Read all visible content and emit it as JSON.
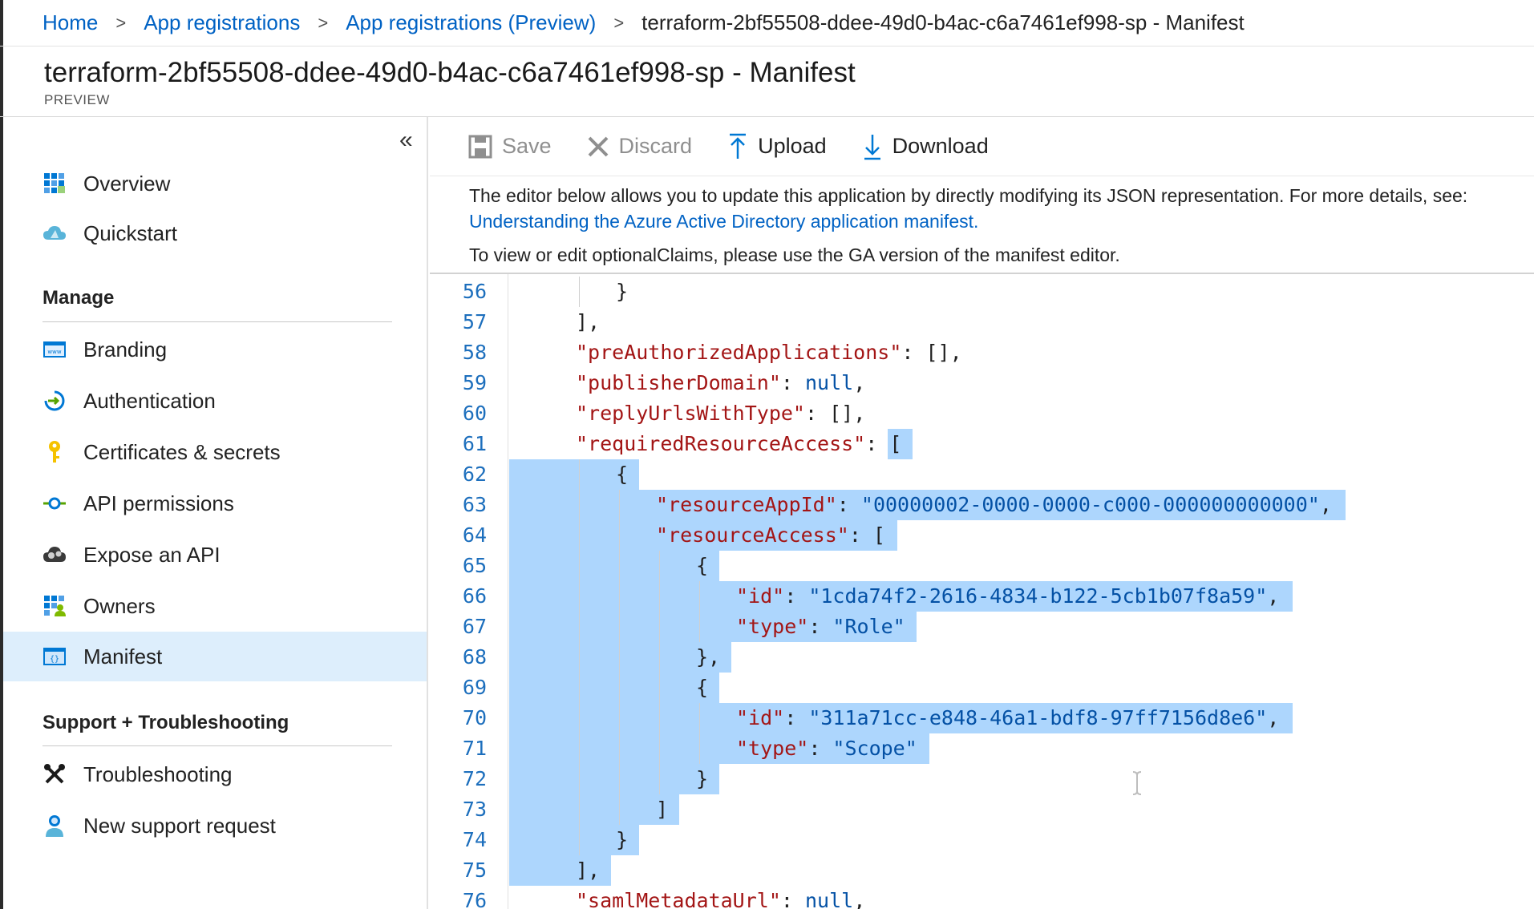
{
  "breadcrumb": {
    "items": [
      "Home",
      "App registrations",
      "App registrations (Preview)"
    ],
    "current": "terraform-2bf55508-ddee-49d0-b4ac-c6a7461ef998-sp - Manifest",
    "separator": ">"
  },
  "header": {
    "title": "terraform-2bf55508-ddee-49d0-b4ac-c6a7461ef998-sp - Manifest",
    "subtitle": "PREVIEW"
  },
  "sidebar": {
    "collapse_glyph": "«",
    "items": [
      {
        "label": "Overview",
        "icon": "grid-icon"
      },
      {
        "label": "Quickstart",
        "icon": "cloud-icon"
      }
    ],
    "manage_label": "Manage",
    "manage_items": [
      {
        "label": "Branding",
        "icon": "browser-icon"
      },
      {
        "label": "Authentication",
        "icon": "arrow-circle-icon"
      },
      {
        "label": "Certificates & secrets",
        "icon": "key-icon"
      },
      {
        "label": "API permissions",
        "icon": "api-icon"
      },
      {
        "label": "Expose an API",
        "icon": "cloud-gear-icon"
      },
      {
        "label": "Owners",
        "icon": "grid-user-icon"
      },
      {
        "label": "Manifest",
        "icon": "manifest-icon",
        "active": true
      }
    ],
    "support_label": "Support + Troubleshooting",
    "support_items": [
      {
        "label": "Troubleshooting",
        "icon": "wrench-icon"
      },
      {
        "label": "New support request",
        "icon": "support-user-icon"
      }
    ]
  },
  "toolbar": {
    "save_label": "Save",
    "discard_label": "Discard",
    "upload_label": "Upload",
    "download_label": "Download"
  },
  "info": {
    "description": "The editor below allows you to update this application by directly modifying its JSON representation. For more details, see:",
    "link": "Understanding the Azure Active Directory application manifest.",
    "note": "To view or edit optionalClaims, please use the GA version of the manifest editor."
  },
  "editor": {
    "lines": [
      {
        "n": "56",
        "indent": 2,
        "tokens": [
          {
            "t": "p",
            "v": "}"
          }
        ]
      },
      {
        "n": "57",
        "indent": 1,
        "tokens": [
          {
            "t": "p",
            "v": "],"
          }
        ]
      },
      {
        "n": "58",
        "indent": 1,
        "tokens": [
          {
            "t": "k",
            "v": "\"preAuthorizedApplications\""
          },
          {
            "t": "p",
            "v": ": [],"
          }
        ]
      },
      {
        "n": "59",
        "indent": 1,
        "tokens": [
          {
            "t": "k",
            "v": "\"publisherDomain\""
          },
          {
            "t": "p",
            "v": ": "
          },
          {
            "t": "n",
            "v": "null"
          },
          {
            "t": "p",
            "v": ","
          }
        ]
      },
      {
        "n": "60",
        "indent": 1,
        "tokens": [
          {
            "t": "k",
            "v": "\"replyUrlsWithType\""
          },
          {
            "t": "p",
            "v": ": [],"
          }
        ]
      },
      {
        "n": "61",
        "indent": 1,
        "tokens": [
          {
            "t": "k",
            "v": "\"requiredResourceAccess\""
          },
          {
            "t": "p",
            "v": ": ["
          }
        ]
      },
      {
        "n": "62",
        "indent": 2,
        "tokens": [
          {
            "t": "p",
            "v": "{"
          }
        ]
      },
      {
        "n": "63",
        "indent": 3,
        "tokens": [
          {
            "t": "k",
            "v": "\"resourceAppId\""
          },
          {
            "t": "p",
            "v": ": "
          },
          {
            "t": "s",
            "v": "\"00000002-0000-0000-c000-000000000000\""
          },
          {
            "t": "p",
            "v": ","
          }
        ]
      },
      {
        "n": "64",
        "indent": 3,
        "tokens": [
          {
            "t": "k",
            "v": "\"resourceAccess\""
          },
          {
            "t": "p",
            "v": ": ["
          }
        ]
      },
      {
        "n": "65",
        "indent": 4,
        "tokens": [
          {
            "t": "p",
            "v": "{"
          }
        ]
      },
      {
        "n": "66",
        "indent": 5,
        "tokens": [
          {
            "t": "k",
            "v": "\"id\""
          },
          {
            "t": "p",
            "v": ": "
          },
          {
            "t": "s",
            "v": "\"1cda74f2-2616-4834-b122-5cb1b07f8a59\""
          },
          {
            "t": "p",
            "v": ","
          }
        ]
      },
      {
        "n": "67",
        "indent": 5,
        "tokens": [
          {
            "t": "k",
            "v": "\"type\""
          },
          {
            "t": "p",
            "v": ": "
          },
          {
            "t": "s",
            "v": "\"Role\""
          }
        ]
      },
      {
        "n": "68",
        "indent": 4,
        "tokens": [
          {
            "t": "p",
            "v": "},"
          }
        ]
      },
      {
        "n": "69",
        "indent": 4,
        "tokens": [
          {
            "t": "p",
            "v": "{"
          }
        ]
      },
      {
        "n": "70",
        "indent": 5,
        "tokens": [
          {
            "t": "k",
            "v": "\"id\""
          },
          {
            "t": "p",
            "v": ": "
          },
          {
            "t": "s",
            "v": "\"311a71cc-e848-46a1-bdf8-97ff7156d8e6\""
          },
          {
            "t": "p",
            "v": ","
          }
        ]
      },
      {
        "n": "71",
        "indent": 5,
        "tokens": [
          {
            "t": "k",
            "v": "\"type\""
          },
          {
            "t": "p",
            "v": ": "
          },
          {
            "t": "s",
            "v": "\"Scope\""
          }
        ]
      },
      {
        "n": "72",
        "indent": 4,
        "tokens": [
          {
            "t": "p",
            "v": "}"
          }
        ]
      },
      {
        "n": "73",
        "indent": 3,
        "tokens": [
          {
            "t": "p",
            "v": "]"
          }
        ]
      },
      {
        "n": "74",
        "indent": 2,
        "tokens": [
          {
            "t": "p",
            "v": "}"
          }
        ]
      },
      {
        "n": "75",
        "indent": 1,
        "tokens": [
          {
            "t": "p",
            "v": "],"
          }
        ]
      },
      {
        "n": "76",
        "indent": 1,
        "tokens": [
          {
            "t": "k",
            "v": "\"samlMetadataUrl\""
          },
          {
            "t": "p",
            "v": ": "
          },
          {
            "t": "n",
            "v": "null"
          },
          {
            "t": "p",
            "v": ","
          }
        ]
      }
    ],
    "selection": {
      "start_line": "61",
      "end_line": "75"
    }
  },
  "colors": {
    "link": "#0062c4",
    "active_nav": "#ddeefc",
    "selection": "#add6fd",
    "json_key": "#a31515",
    "json_value": "#0451a5",
    "line_number": "#1d6fbd"
  }
}
